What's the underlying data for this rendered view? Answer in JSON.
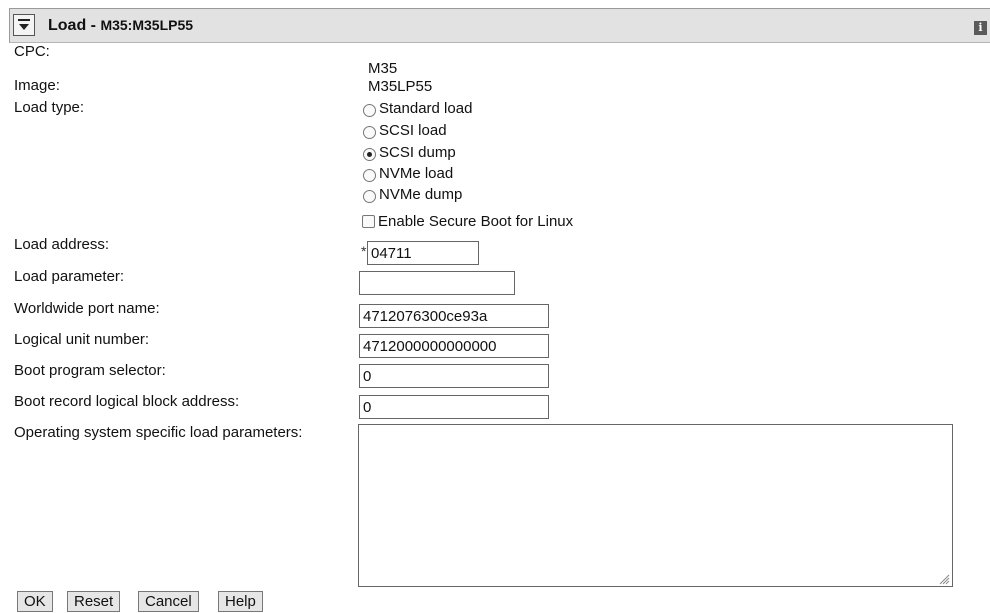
{
  "header": {
    "title": "Load - ",
    "subtitle": "M35:M35LP55",
    "menu_icon": "chevron-down-icon",
    "info_icon": "info-icon",
    "info_glyph": "i"
  },
  "form": {
    "cpc_label": "CPC:",
    "cpc_value": "M35",
    "image_label": "Image:",
    "image_value": "M35LP55",
    "load_type_label": "Load type:",
    "load_types": [
      "Standard load",
      "SCSI load",
      "SCSI dump",
      "NVMe load",
      "NVMe dump"
    ],
    "load_type_selected": "SCSI dump",
    "secure_boot_label": "Enable Secure Boot for Linux",
    "secure_boot_checked": false,
    "required_marker": "*",
    "load_address_label": "Load address:",
    "load_address_value": "04711",
    "load_parameter_label": "Load parameter:",
    "load_parameter_value": "",
    "wwpn_label": "Worldwide port name:",
    "wwpn_value": "4712076300ce93a",
    "lun_label": "Logical unit number:",
    "lun_value": "4712000000000000",
    "bps_label": "Boot program selector:",
    "bps_value": "0",
    "brlba_label": "Boot record logical block address:",
    "brlba_value": "0",
    "os_params_label": "Operating system specific load parameters:",
    "os_params_value": ""
  },
  "buttons": {
    "ok": "OK",
    "reset": "Reset",
    "cancel": "Cancel",
    "help": "Help"
  }
}
